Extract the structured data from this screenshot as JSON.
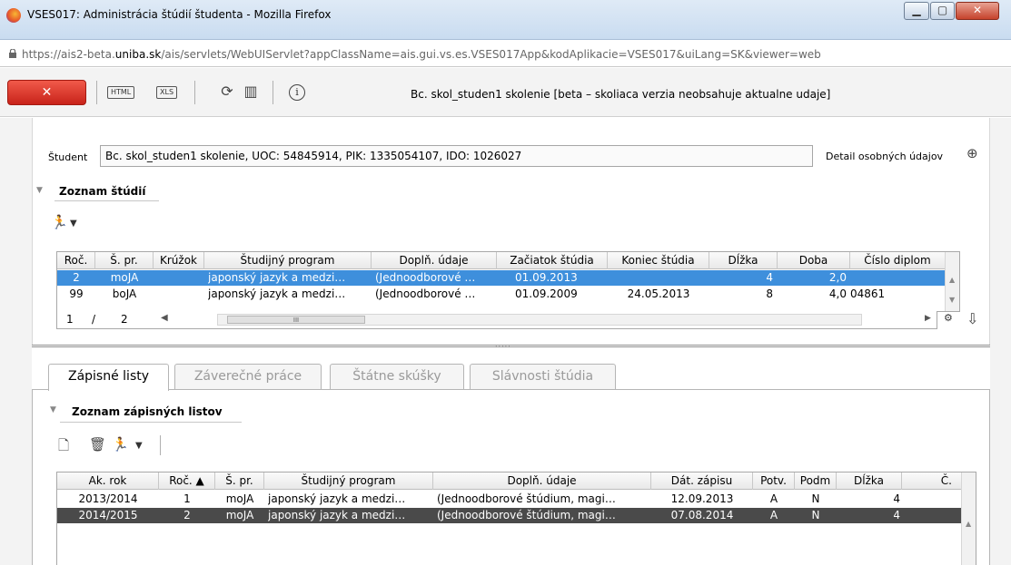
{
  "window": {
    "title": "VSES017: Administrácia štúdií študenta - Mozilla Firefox",
    "url_prefix": "https://ais2-beta.",
    "url_domain": "uniba.sk",
    "url_suffix": "/ais/servlets/WebUIServlet?appClassName=ais.gui.vs.es.VSES017App&kodAplikacie=VSES017&uiLang=SK&viewer=web"
  },
  "toolbar": {
    "close_label": "✕",
    "html_label": "HTML",
    "xls_label": "XLS",
    "info_label": "i",
    "user_text": "Bc. skol_studen1 skolenie [beta – skoliaca verzia neobsahuje aktualne udaje]"
  },
  "student": {
    "label": "Študent",
    "value": "Bc. skol_studen1 skolenie, UOC: 54845914, PIK: 1335054107, IDO: 1026027",
    "detail_link": "Detail osobných údajov"
  },
  "studies": {
    "title": "Zoznam štúdií",
    "columns": [
      "Roč.",
      "Š. pr.",
      "Krúžok",
      "Študijný program",
      "Doplň. údaje",
      "Začiatok štúdia",
      "Koniec štúdia",
      "Dĺžka",
      "Doba",
      "Číslo diplom"
    ],
    "rows": [
      [
        "2",
        "moJA",
        "",
        "japonský jazyk a medzi…",
        "(Jednoodborové …",
        "01.09.2013",
        "",
        "4",
        "2,0",
        ""
      ],
      [
        "99",
        "boJA",
        "",
        "japonský jazyk a medzi…",
        "(Jednoodborové …",
        "01.09.2009",
        "24.05.2013",
        "8",
        "4,0",
        "04861"
      ]
    ],
    "pager": {
      "current": "1",
      "sep": "/",
      "total": "2",
      "thumb": "III"
    }
  },
  "tabs": [
    {
      "label": "Zápisné listy"
    },
    {
      "label": "Záverečné práce"
    },
    {
      "label": "Štátne skúšky"
    },
    {
      "label": "Slávnosti štúdia"
    }
  ],
  "enrollment": {
    "title": "Zoznam zápisných listov",
    "columns": [
      "Ak. rok",
      "Roč. ▲",
      "Š. pr.",
      "Študijný program",
      "Doplň. údaje",
      "Dát. zápisu",
      "Potv.",
      "Podm",
      "Dĺžka",
      "Č."
    ],
    "rows": [
      [
        "2013/2014",
        "1",
        "moJA",
        "japonský jazyk a medzi…",
        "(Jednoodborové štúdium, magi…",
        "12.09.2013",
        "A",
        "N",
        "4",
        ""
      ],
      [
        "2014/2015",
        "2",
        "moJA",
        "japonský jazyk a medzi…",
        "(Jednoodborové štúdium, magi…",
        "07.08.2014",
        "A",
        "N",
        "4",
        ""
      ]
    ]
  }
}
